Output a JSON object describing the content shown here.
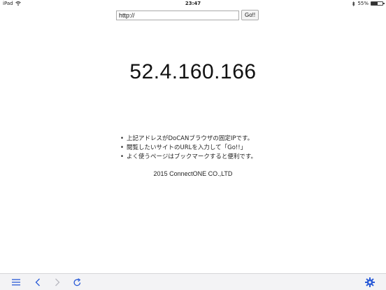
{
  "status_bar": {
    "device": "iPad",
    "time": "23:47",
    "battery": "55%",
    "battery_level": 0.55
  },
  "url_bar": {
    "value": "http://",
    "go_label": "Go!!"
  },
  "ip_address": "52.4.160.166",
  "notes": [
    "上記アドレスがDoCANブラウザの固定IPです。",
    "閲覧したいサイトのURLを入力して「Go!!」",
    "よく使うページはブックマークすると便利です。"
  ],
  "copyright": "2015 ConnectONE CO.,LTD",
  "toolbar": {
    "icons": [
      "menu-icon",
      "back-icon",
      "forward-icon",
      "reload-icon",
      "gear-icon"
    ],
    "accent_color": "#2a5bd7",
    "disabled_color": "#b8b8c0"
  }
}
